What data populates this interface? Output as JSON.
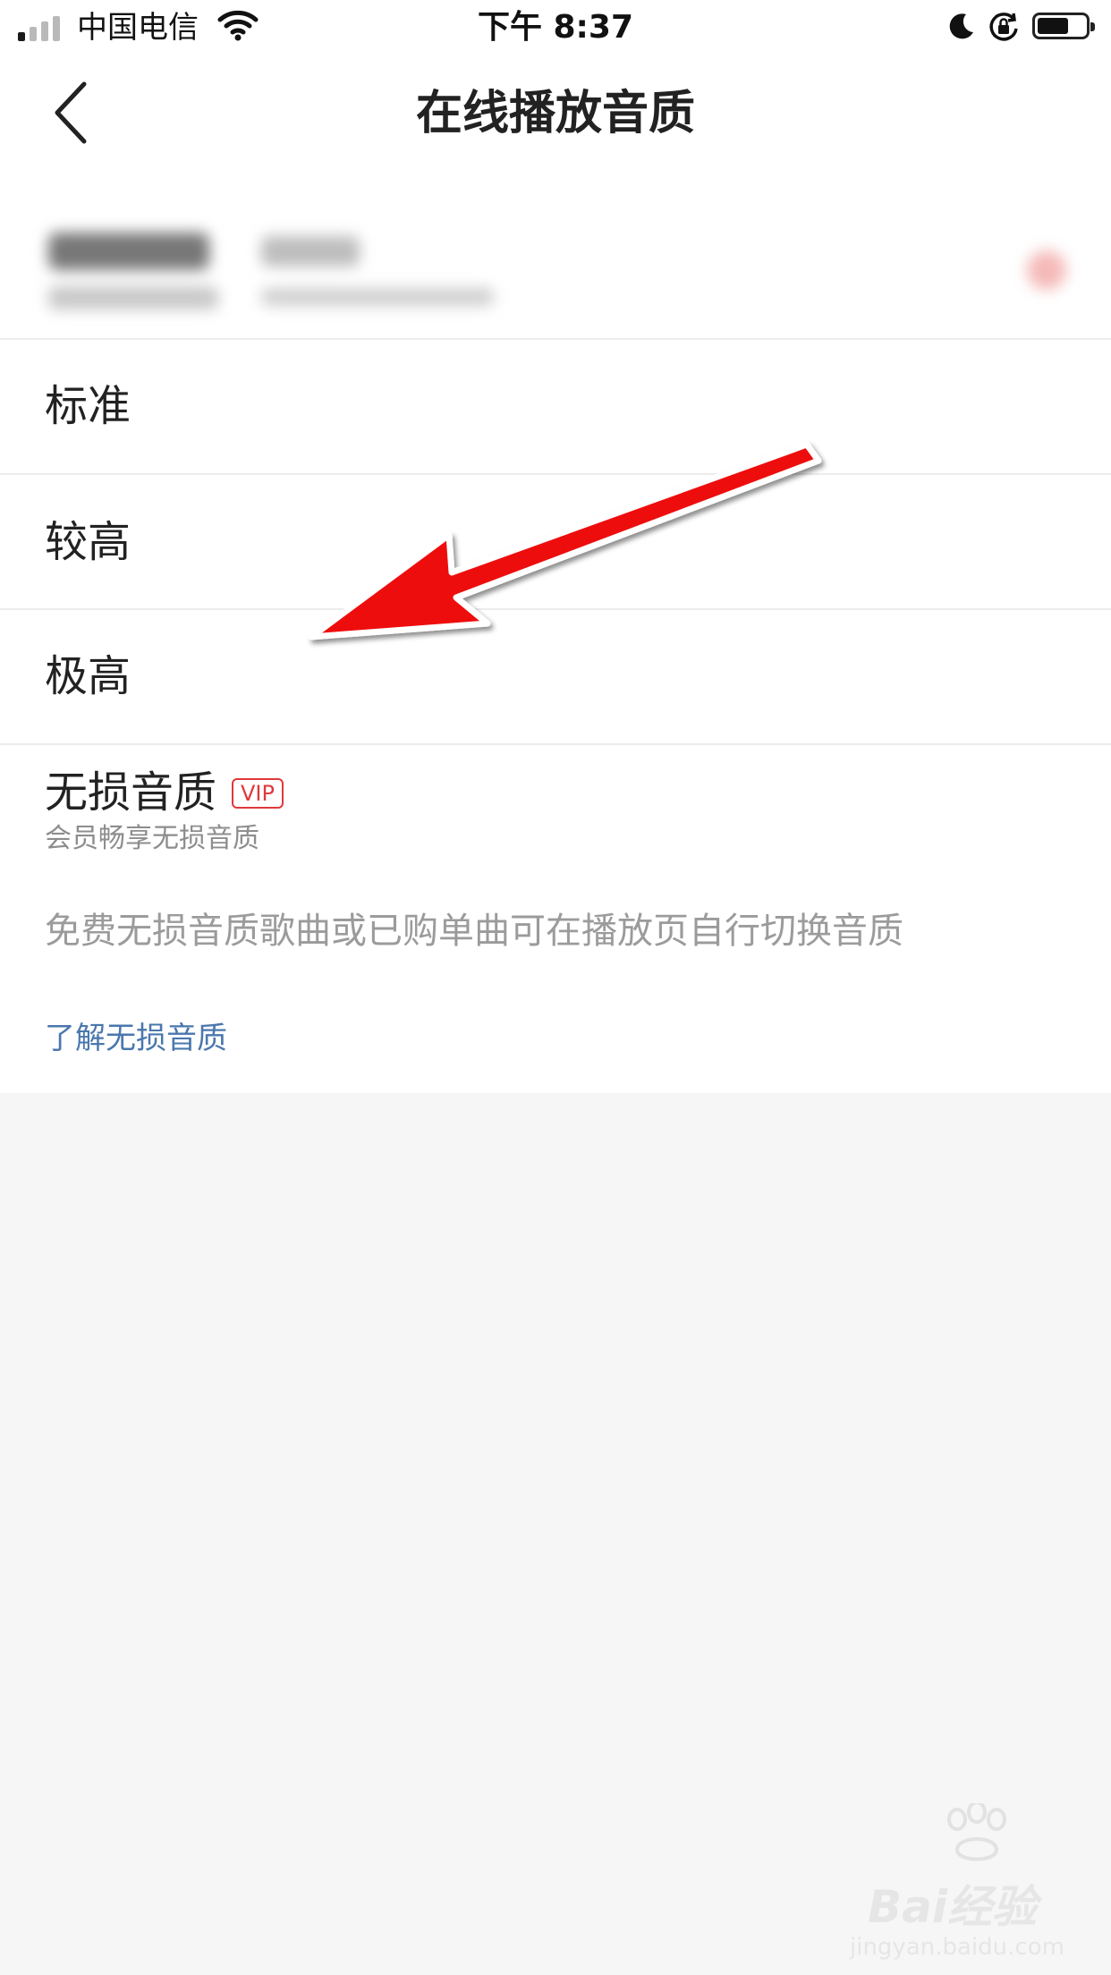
{
  "status_bar": {
    "carrier": "中国电信",
    "time": "下午 8:37",
    "signal_bars_filled": 1,
    "signal_bars_total": 4,
    "battery_level": 0.6
  },
  "header": {
    "title": "在线播放音质",
    "back_icon": "chevron-left-icon"
  },
  "options": [
    {
      "label": "标准"
    },
    {
      "label": "较高"
    },
    {
      "label": "极高"
    }
  ],
  "lossless": {
    "title": "无损音质",
    "badge": "VIP",
    "subtitle": "会员畅享无损音质"
  },
  "note": "免费无损音质歌曲或已购单曲可在播放页自行切换音质",
  "link": "了解无损音质",
  "watermark": {
    "main": "Bai经验",
    "sub": "jingyan.baidu.com"
  },
  "colors": {
    "annotation_arrow": "#ee1111",
    "vip": "#e0393a",
    "link": "#4a77ad",
    "background": "#f6f6f6"
  }
}
